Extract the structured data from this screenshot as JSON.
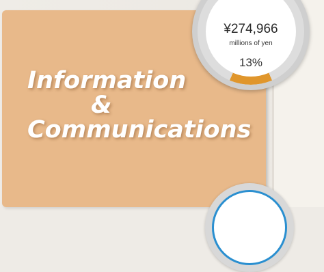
{
  "segment": {
    "title_line_1": "Information",
    "title_line_2": "&",
    "title_line_3": "Communications",
    "card_color": "#e8b98a"
  },
  "stat": {
    "value": "¥274,966",
    "unit": "millions of yen",
    "share_text": "13%",
    "share_fraction": 0.13,
    "accent_color": "#e0962c",
    "ring_color": "#dddddd"
  },
  "next_segment": {
    "accent_color": "#2a8fd0"
  }
}
